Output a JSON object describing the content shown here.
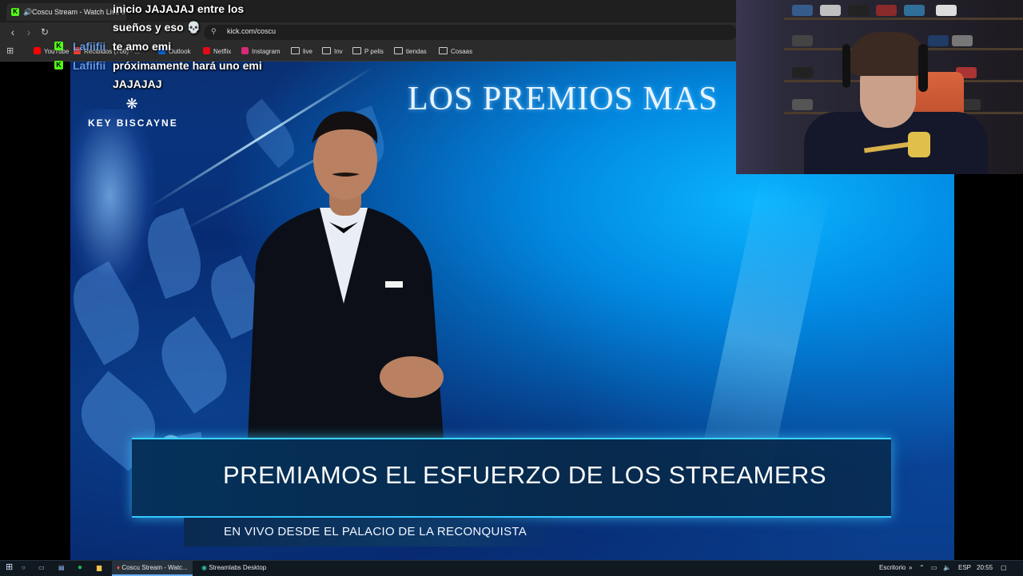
{
  "browser": {
    "tab_title": "Coscu Stream - Watch Live o",
    "url": "kick.com/coscu",
    "bookmarks": [
      {
        "label": "YouTube",
        "icon": "youtube-icon",
        "color": "#ff0000"
      },
      {
        "label": "Recibidos (766) - ...",
        "icon": "gmail-icon",
        "color": "#ea4335"
      },
      {
        "label": "Outlook",
        "icon": "outlook-icon",
        "color": "#0a64d6"
      },
      {
        "label": "Netflix",
        "icon": "netflix-icon",
        "color": "#e50914"
      },
      {
        "label": "Instagram",
        "icon": "instagram-icon",
        "color": "#d62976"
      },
      {
        "label": "live",
        "icon": "folder-icon"
      },
      {
        "label": "Inv",
        "icon": "folder-icon"
      },
      {
        "label": "P pelis",
        "icon": "folder-icon"
      },
      {
        "label": "tiendas",
        "icon": "folder-icon"
      },
      {
        "label": "Cosaas",
        "icon": "folder-icon"
      }
    ]
  },
  "chat": [
    {
      "user": "",
      "text": "inicio JAJAJAJ entre los"
    },
    {
      "user": "",
      "text": "sueños y eso 💀"
    },
    {
      "user": "Lafiifii",
      "text": "te amo emi"
    },
    {
      "user": "Lafiifii",
      "text": "próximamente hará uno emi"
    },
    {
      "user": "",
      "text": "JAJAJAJ"
    }
  ],
  "stage": {
    "brand": "KEY BISCAYNE",
    "hero_title": "LOS PREMIOS MAS",
    "banner_title": "PREMIAMOS EL ESFUERZO DE LOS STREAMERS",
    "banner_subtitle": "EN VIVO DESDE EL PALACIO DE LA RECONQUISTA"
  },
  "taskbar": {
    "apps": [
      {
        "label": "Coscu Stream - Watc...",
        "icon": "brave-icon",
        "active": true
      },
      {
        "label": "Streamlabs Desktop",
        "icon": "streamlabs-icon",
        "active": false
      }
    ],
    "desktop_label": "Escritorio",
    "language": "ESP",
    "time": "20:55"
  },
  "colors": {
    "kick_green": "#53fc18",
    "banner_glow": "#33c9ff"
  }
}
